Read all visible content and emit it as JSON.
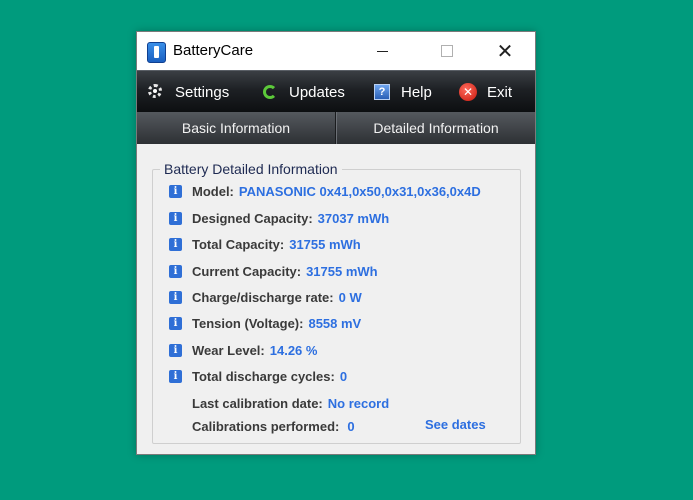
{
  "window": {
    "title": "BatteryCare"
  },
  "toolbar": {
    "settings": "Settings",
    "updates": "Updates",
    "help": "Help",
    "exit": "Exit"
  },
  "tabs": {
    "basic": "Basic Information",
    "detailed": "Detailed Information"
  },
  "group": {
    "title": "Battery Detailed Information"
  },
  "details": [
    {
      "label": "Model:",
      "value": "PANASONIC  0x41,0x50,0x31,0x36,0x4D"
    },
    {
      "label": "Designed Capacity:",
      "value": "37037 mWh"
    },
    {
      "label": "Total Capacity:",
      "value": "31755 mWh"
    },
    {
      "label": "Current Capacity:",
      "value": "31755 mWh"
    },
    {
      "label": "Charge/discharge rate:",
      "value": "0 W"
    },
    {
      "label": "Tension (Voltage):",
      "value": "8558 mV"
    },
    {
      "label": "Wear Level:",
      "value": "14.26 %"
    },
    {
      "label": "Total discharge cycles:",
      "value": "0"
    }
  ],
  "calibration": {
    "last_label": "Last calibration date:",
    "last_value": "No record",
    "count_label": "Calibrations performed:",
    "count_value": "0",
    "see_dates": "See dates"
  }
}
